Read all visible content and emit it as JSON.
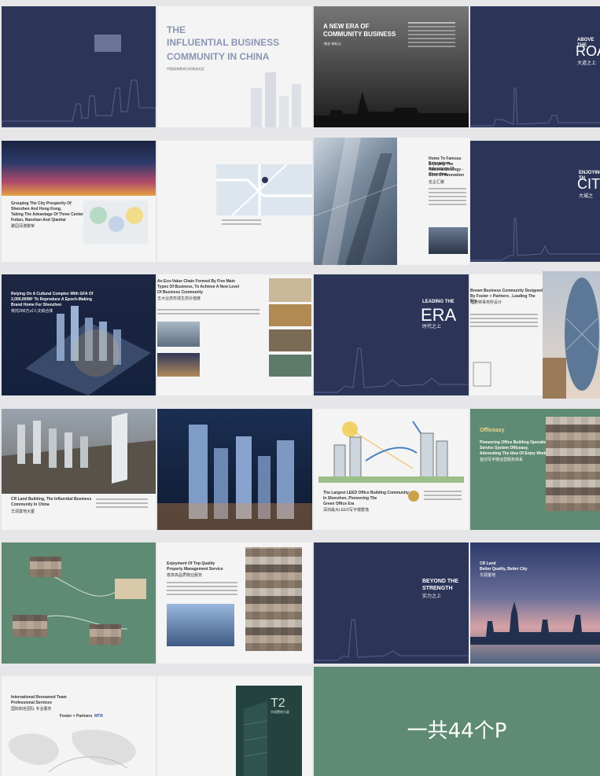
{
  "pages": {
    "p01": {
      "title": ""
    },
    "p02": {
      "the": "THE",
      "line1": "INFLUENTIAL BUSINESS",
      "line2": "COMMUNITY IN CHINA",
      "cn": "中国具有影响力的商务社区"
    },
    "p03": {
      "line1": "A NEW ERA OF",
      "line2": "COMMUNITY BUSINESS",
      "cn": "\"商业\"新纪元"
    },
    "p04": {
      "line1": "ABOVE THE",
      "big": "ROAD",
      "cn": "大道之上"
    },
    "p06": {
      "line1": "Grouping The City Prosperity Of",
      "line2": "Shenzhen And Hong Kong,",
      "line3": "Taking The Advantage Of Three Centers -",
      "line4": "Futian, Nanshan And Qianhai",
      "cn": "聚园深港繁荣"
    },
    "p08": {
      "line1": "Home To Famous Enterprises,",
      "line2": "Enjoying The Advantage Of",
      "line3": "National Strategy - Shenzhen,",
      "line4": "Core Of Innovation",
      "cn": "名企汇聚"
    },
    "p09": {
      "line1": "ENJOYING TH",
      "big": "CITY",
      "cn": "大城之"
    },
    "p10": {
      "line1": "Relying On A Cultural Complex With GFA Of",
      "line2": "2,000,000M² To Reproduce A Epoch-Making",
      "line3": "Brand Home For Shenzhen",
      "cn": "依托200万㎡人文综合体"
    },
    "p11": {
      "line1": "An Eco-Value Chain Formed By Five Main",
      "line2": "Types Of Business, To Achieve A New Level",
      "line3": "Of Business Community",
      "cn": "五大业态形成生态价值链"
    },
    "p12": {
      "line1": "LEADING THE",
      "big": "ERA",
      "cn": "时代之上"
    },
    "p13": {
      "line1": "Brown Business Community Designed",
      "line2": "By Foster + Partners , Leading The Era",
      "cn": "福斯特事务所设计"
    },
    "p15": {
      "line1": "CR Land Building, The Influential Business",
      "line2": "Community In China",
      "cn": "华润置地大厦"
    },
    "p17": {
      "line1": "The Largest LEED Office Building Community",
      "line2": "In Shenzhen, Pioneering The",
      "line3": "Green Office Era",
      "cn": "深圳最大LEED写字楼群落"
    },
    "p18": {
      "logo": "Officeasy",
      "line1": "Pioneering Office Building Operation",
      "line2": "Service System Officeasy,",
      "line3": "Advocating The Idea Of Enjoy Work",
      "cn": "首创写字楼运营服务体系"
    },
    "p20": {
      "line1": "Enjoyment Of Top-Quality",
      "line2": "Property Management Service",
      "cn": "尊享高品质物业服务"
    },
    "p22": {
      "line1": "BEYOND THE",
      "line2": "STRENGTH",
      "cn": "实力之上"
    },
    "p23": {
      "line1": "CR Land",
      "line2": "Better Quality, Better City",
      "cn": "华润置地"
    },
    "p24": {
      "line1": "International Renowned Team",
      "line2": "Professional Services",
      "cn": "国际知名团队 专业服务",
      "brand1": "Foster + Partners",
      "brand2": "MTR"
    },
    "p25": {
      "big": "T2",
      "cn": "华润置地大厦"
    },
    "p26": {
      "label": "一共44个P"
    }
  },
  "colors": {
    "navy": "#2c3558",
    "green": "#5f8a73",
    "paper": "#f4f4f4"
  }
}
